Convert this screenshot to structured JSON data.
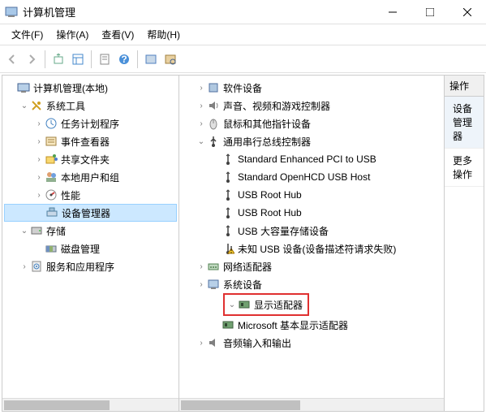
{
  "window": {
    "title": "计算机管理"
  },
  "menu": [
    "文件(F)",
    "操作(A)",
    "查看(V)",
    "帮助(H)"
  ],
  "left_tree": {
    "root": "计算机管理(本地)",
    "nodes": [
      {
        "label": "系统工具",
        "expanded": true,
        "children": [
          {
            "label": "任务计划程序"
          },
          {
            "label": "事件查看器"
          },
          {
            "label": "共享文件夹"
          },
          {
            "label": "本地用户和组"
          },
          {
            "label": "性能"
          },
          {
            "label": "设备管理器",
            "selected": true
          }
        ]
      },
      {
        "label": "存储",
        "expanded": true,
        "children": [
          {
            "label": "磁盘管理"
          }
        ]
      },
      {
        "label": "服务和应用程序",
        "expanded": false
      }
    ]
  },
  "mid_tree": [
    {
      "label": "软件设备",
      "expanded": false
    },
    {
      "label": "声音、视频和游戏控制器",
      "expanded": false
    },
    {
      "label": "鼠标和其他指针设备",
      "expanded": false
    },
    {
      "label": "通用串行总线控制器",
      "expanded": true,
      "children": [
        {
          "label": "Standard Enhanced PCI to USB"
        },
        {
          "label": "Standard OpenHCD USB Host"
        },
        {
          "label": "USB Root Hub"
        },
        {
          "label": "USB Root Hub"
        },
        {
          "label": "USB 大容量存储设备"
        },
        {
          "label": "未知 USB 设备(设备描述符请求失败)",
          "warn": true
        }
      ]
    },
    {
      "label": "网络适配器",
      "expanded": false
    },
    {
      "label": "系统设备",
      "expanded": false
    },
    {
      "label": "显示适配器",
      "expanded": true,
      "highlight": true,
      "children": [
        {
          "label": "Microsoft 基本显示适配器"
        }
      ]
    },
    {
      "label": "音频输入和输出",
      "expanded": false
    }
  ],
  "actions": {
    "header": "操作",
    "section": "设备管理器",
    "more": "更多操作"
  }
}
